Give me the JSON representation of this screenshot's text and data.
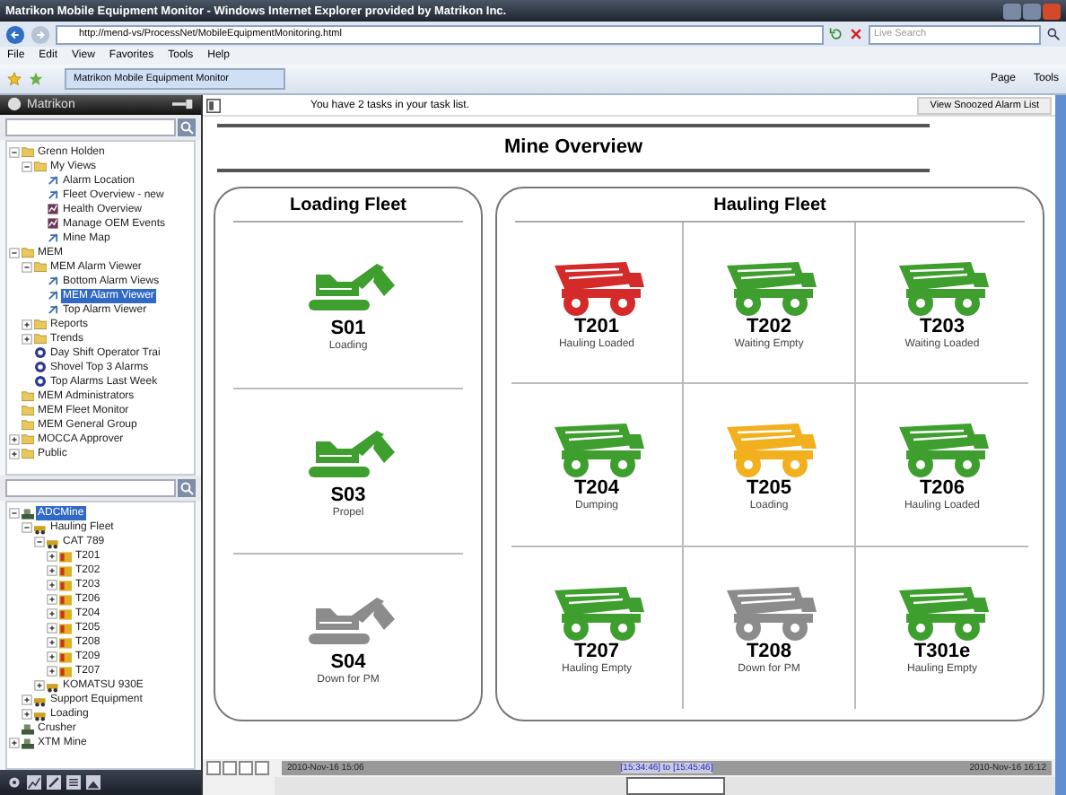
{
  "window": {
    "title": "Matrikon Mobile Equipment Monitor - Windows Internet Explorer provided by Matrikon Inc."
  },
  "address_bar": {
    "url": "http://mend-vs/ProcessNet/MobileEquipmentMonitoring.html",
    "search_placeholder": "Live Search"
  },
  "menu": [
    "File",
    "Edit",
    "View",
    "Favorites",
    "Tools",
    "Help"
  ],
  "browser_tab": {
    "label": "Matrikon Mobile Equipment Monitor"
  },
  "command_bar": [
    "Page",
    "Tools"
  ],
  "sidebar": {
    "brand": "Matrikon",
    "top_tree": [
      {
        "label": "Grenn Holden",
        "kind": "folder",
        "expanded": true,
        "selected": false,
        "children": [
          {
            "label": "My Views",
            "kind": "folder",
            "expanded": true,
            "selected": false,
            "children": [
              {
                "label": "Alarm Location",
                "kind": "view",
                "selected": false
              },
              {
                "label": "Fleet Overview - new",
                "kind": "view",
                "selected": false
              },
              {
                "label": "Health Overview",
                "kind": "report",
                "selected": false
              },
              {
                "label": "Manage OEM Events",
                "kind": "report",
                "selected": false
              },
              {
                "label": "Mine Map",
                "kind": "view",
                "selected": false
              }
            ]
          }
        ]
      },
      {
        "label": "MEM",
        "kind": "folder",
        "expanded": true,
        "selected": false,
        "children": [
          {
            "label": "MEM Alarm Viewer",
            "kind": "folder",
            "expanded": true,
            "selected": false,
            "children": [
              {
                "label": "Bottom Alarm Views",
                "kind": "view",
                "selected": false
              },
              {
                "label": "MEM Alarm Viewer",
                "kind": "view",
                "selected": true
              },
              {
                "label": "Top Alarm Viewer",
                "kind": "view",
                "selected": false
              }
            ]
          },
          {
            "label": "Reports",
            "kind": "folder",
            "expanded": false,
            "selected": false
          },
          {
            "label": "Trends",
            "kind": "folder",
            "expanded": false,
            "selected": false
          },
          {
            "label": "Day Shift Operator Trai",
            "kind": "trend",
            "selected": false
          },
          {
            "label": "Shovel Top 3 Alarms",
            "kind": "trend",
            "selected": false
          },
          {
            "label": "Top Alarms Last Week",
            "kind": "trend",
            "selected": false
          }
        ]
      },
      {
        "label": "MEM Administrators",
        "kind": "folder",
        "selected": false
      },
      {
        "label": "MEM Fleet Monitor",
        "kind": "folder",
        "selected": false
      },
      {
        "label": "MEM General Group",
        "kind": "folder",
        "selected": false
      },
      {
        "label": "MOCCA Approver",
        "kind": "folder",
        "expanded": false,
        "selected": false
      },
      {
        "label": "Public",
        "kind": "folder",
        "expanded": false,
        "selected": false
      }
    ],
    "bottom_tree": [
      {
        "label": "ADCMine",
        "kind": "site",
        "expanded": true,
        "selected": true,
        "children": [
          {
            "label": "Hauling Fleet",
            "kind": "equipment",
            "expanded": true,
            "selected": false,
            "children": [
              {
                "label": "CAT 789",
                "kind": "equipment",
                "expanded": true,
                "selected": false,
                "children": [
                  {
                    "label": "T201",
                    "kind": "unit",
                    "expanded": false,
                    "selected": false
                  },
                  {
                    "label": "T202",
                    "kind": "unit",
                    "expanded": false,
                    "selected": false
                  },
                  {
                    "label": "T203",
                    "kind": "unit",
                    "expanded": false,
                    "selected": false
                  },
                  {
                    "label": "T206",
                    "kind": "unit",
                    "expanded": false,
                    "selected": false
                  },
                  {
                    "label": "T204",
                    "kind": "unit",
                    "expanded": false,
                    "selected": false
                  },
                  {
                    "label": "T205",
                    "kind": "unit",
                    "expanded": false,
                    "selected": false
                  },
                  {
                    "label": "T208",
                    "kind": "unit",
                    "expanded": false,
                    "selected": false
                  },
                  {
                    "label": "T209",
                    "kind": "unit",
                    "expanded": false,
                    "selected": false
                  },
                  {
                    "label": "T207",
                    "kind": "unit",
                    "expanded": false,
                    "selected": false
                  }
                ]
              },
              {
                "label": "KOMATSU 930E",
                "kind": "equipment",
                "expanded": false,
                "selected": false
              }
            ]
          },
          {
            "label": "Support Equipment",
            "kind": "equipment",
            "expanded": false,
            "selected": false
          },
          {
            "label": "Loading",
            "kind": "equipment",
            "expanded": false,
            "selected": false
          }
        ]
      },
      {
        "label": "Crusher",
        "kind": "site",
        "selected": false
      },
      {
        "label": "XTM Mine",
        "kind": "site",
        "expanded": false,
        "selected": false
      }
    ]
  },
  "task_bar": {
    "message": "You have 2 tasks in your task list.",
    "button": "View Snoozed Alarm List"
  },
  "page_title": "Mine Overview",
  "loading_fleet": {
    "title": "Loading Fleet",
    "units": [
      {
        "name": "S01",
        "status": "Loading",
        "color": "#3e9e2e"
      },
      {
        "name": "S03",
        "status": "Propel",
        "color": "#3e9e2e"
      },
      {
        "name": "S04",
        "status": "Down for PM",
        "color": "#8c8c8c"
      }
    ]
  },
  "hauling_fleet": {
    "title": "Hauling Fleet",
    "units": [
      {
        "name": "T201",
        "status": "Hauling Loaded",
        "color": "#d42a2a"
      },
      {
        "name": "T202",
        "status": "Waiting Empty",
        "color": "#3e9e2e"
      },
      {
        "name": "T203",
        "status": "Waiting Loaded",
        "color": "#3e9e2e"
      },
      {
        "name": "T204",
        "status": "Dumping",
        "color": "#3e9e2e"
      },
      {
        "name": "T205",
        "status": "Loading",
        "color": "#f2b01e"
      },
      {
        "name": "T206",
        "status": "Hauling Loaded",
        "color": "#3e9e2e"
      },
      {
        "name": "T207",
        "status": "Hauling Empty",
        "color": "#3e9e2e"
      },
      {
        "name": "T208",
        "status": "Down for PM",
        "color": "#8c8c8c"
      },
      {
        "name": "T301e",
        "status": "Hauling Empty",
        "color": "#3e9e2e"
      }
    ]
  },
  "timeline": {
    "start": "2010-Nov-16 15:06",
    "range": "[15:34:46] to [15:45:46]",
    "end": "2010-Nov-16 16:12"
  }
}
